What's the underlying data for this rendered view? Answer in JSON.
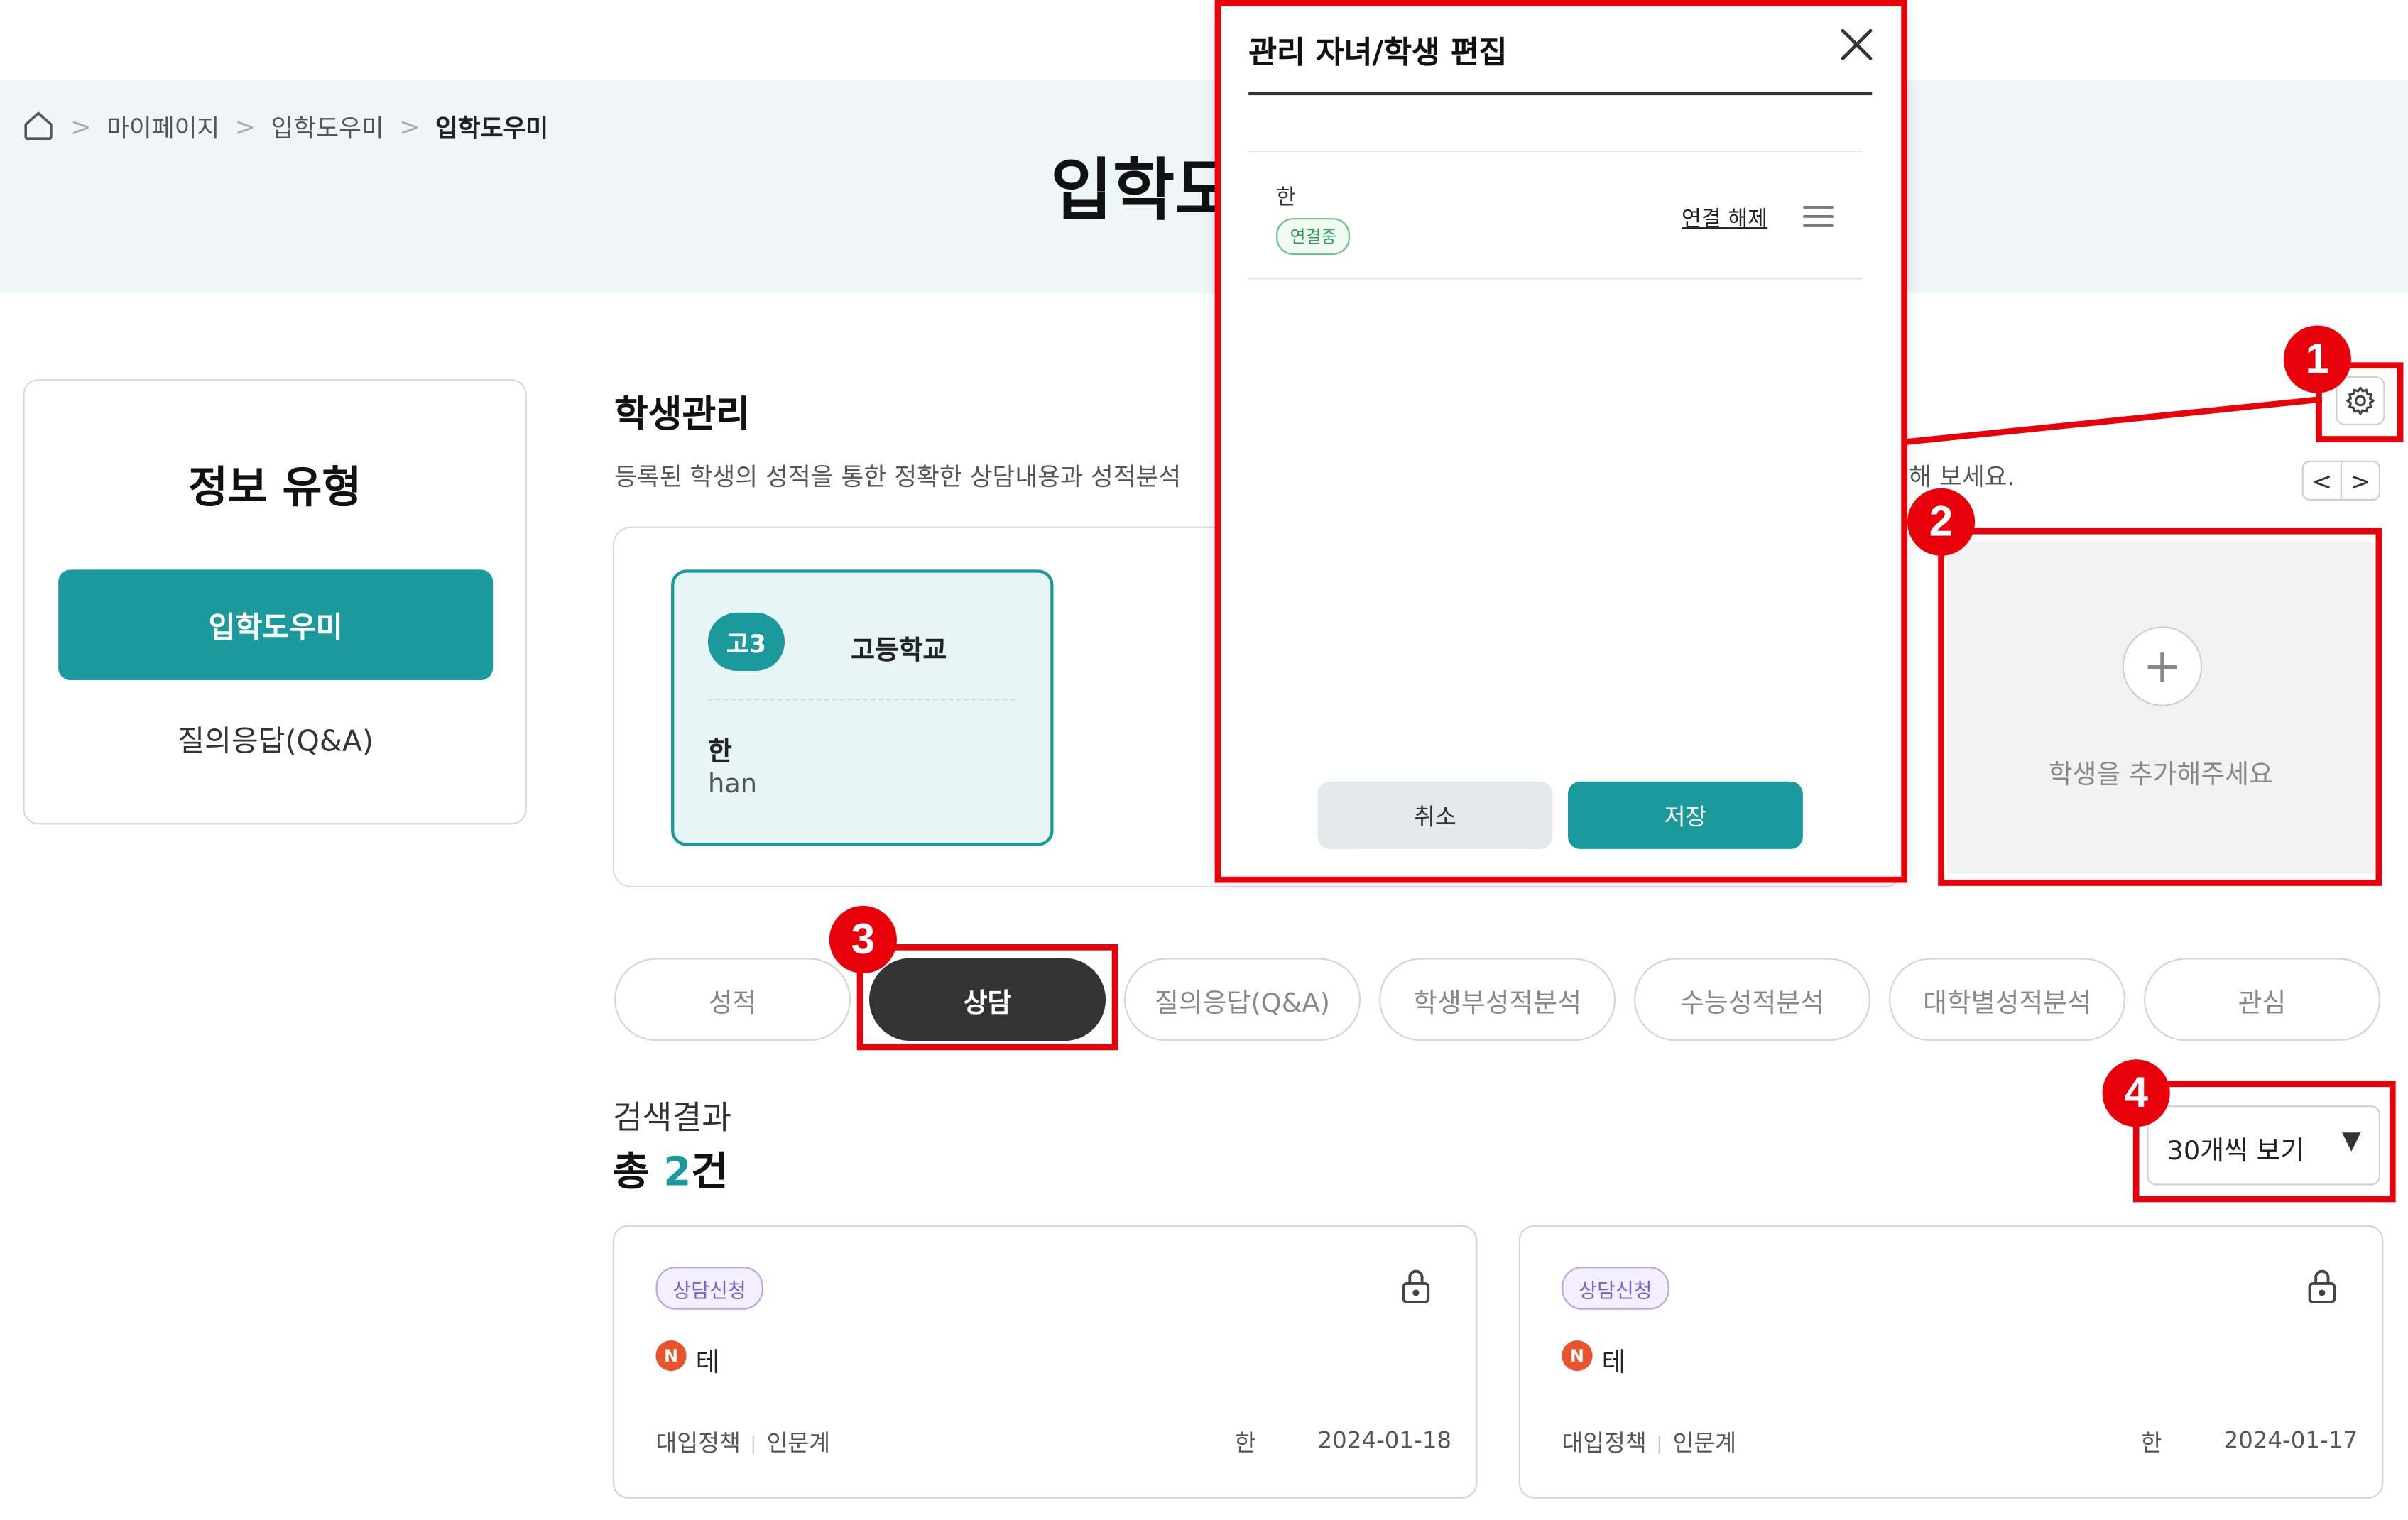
{
  "breadcrumb": {
    "items": [
      "마이페이지",
      "입학도우미"
    ],
    "current": "입학도우미",
    "separator": ">"
  },
  "header": {
    "title": "입학도우미"
  },
  "info_panel": {
    "title": "정보 유형",
    "items": [
      {
        "label": "입학도우미",
        "active": true
      },
      {
        "label": "질의응답(Q&A)",
        "active": false
      }
    ]
  },
  "student_section": {
    "title": "학생관리",
    "description": "등록된 학생의 성적을 통한 정확한 상담내용과 성적분석",
    "description_tail": "해 보세요.",
    "student": {
      "grade": "고3",
      "school": "고등학교",
      "name_ko": "한",
      "name_en": "han"
    },
    "add_text": "학생을 추가해주세요",
    "nav": {
      "prev": "<",
      "next": ">"
    }
  },
  "tabs": [
    {
      "label": "성적",
      "active": false
    },
    {
      "label": "상담",
      "active": true
    },
    {
      "label": "질의응답(Q&A)",
      "active": false
    },
    {
      "label": "학생부성적분석",
      "active": false
    },
    {
      "label": "수능성적분석",
      "active": false
    },
    {
      "label": "대학별성적분석",
      "active": false
    },
    {
      "label": "관심",
      "active": false
    }
  ],
  "results": {
    "label": "검색결과",
    "total_prefix": "총",
    "count": "2",
    "total_suffix": "건",
    "view_option": "30개씩 보기"
  },
  "posts": [
    {
      "badge": "상담신청",
      "new_badge": "N",
      "title": "테",
      "category": "대입정책",
      "subcategory": "인문계",
      "author": "한",
      "date": "2024-01-18"
    },
    {
      "badge": "상담신청",
      "new_badge": "N",
      "title": "테",
      "category": "대입정책",
      "subcategory": "인문계",
      "author": "한",
      "date": "2024-01-17"
    }
  ],
  "modal": {
    "title": "관리 자녀/학생 편집",
    "child_name": "한",
    "status": "연결중",
    "unlink": "연결 해제",
    "cancel": "취소",
    "save": "저장"
  },
  "annotations": [
    "1",
    "2",
    "3",
    "4"
  ],
  "colors": {
    "accent": "#1b9a9e",
    "header_bg": "#eef6f6",
    "annotation": "#e8000b",
    "new_badge": "#e8542e",
    "status_green": "#2e9b57",
    "badge_purple": "#7b61c9"
  },
  "icons": {
    "home": "home-icon",
    "settings": "gear-icon",
    "lock": "lock-icon",
    "close": "close-icon",
    "drag": "drag-handle-icon",
    "add": "plus-icon",
    "dropdown": "caret-down-icon"
  }
}
